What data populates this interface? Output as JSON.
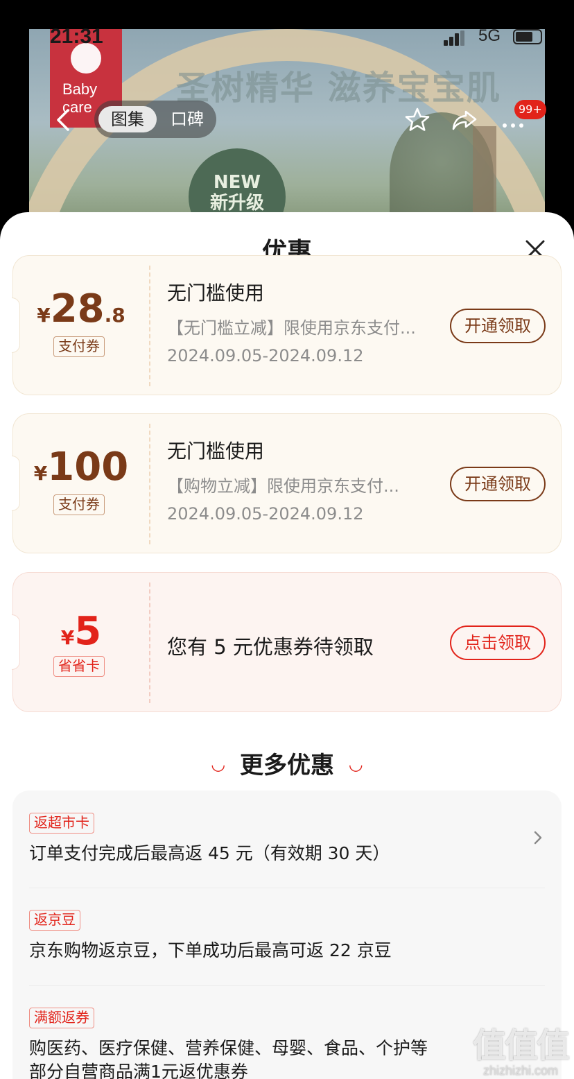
{
  "status_bar": {
    "time": "21:31",
    "network": "5G"
  },
  "product_hero": {
    "brand": "Baby care",
    "slogan": "圣树精华 滋养宝宝肌",
    "badge_line1": "NEW",
    "badge_line2": "新升级"
  },
  "nav": {
    "tabs": [
      "图集",
      "口碑"
    ],
    "active_tab": "图集",
    "message_badge": "99+"
  },
  "sheet": {
    "title": "优惠",
    "coupons": [
      {
        "currency": "¥",
        "amount_int": "28",
        "amount_dec": ".8",
        "tag": "支付券",
        "title": "无门槛使用",
        "desc": "【无门槛立减】限使用京东支付...",
        "date": "2024.09.05-2024.09.12",
        "button": "开通领取"
      },
      {
        "currency": "¥",
        "amount_int": "100",
        "amount_dec": "",
        "tag": "支付券",
        "title": "无门槛使用",
        "desc": "【购物立减】限使用京东支付...",
        "date": "2024.09.05-2024.09.12",
        "button": "开通领取"
      },
      {
        "currency": "¥",
        "amount_int": "5",
        "amount_dec": "",
        "tag": "省省卡",
        "text": "您有 5 元优惠券待领取",
        "button": "点击领取"
      }
    ],
    "more": {
      "title": "更多优惠",
      "items": [
        {
          "tag": "返超市卡",
          "text": "订单支付完成后最高返 45 元（有效期 30 天）"
        },
        {
          "tag": "返京豆",
          "text": "京东购物返京豆，下单成功后最高可返 22 京豆"
        },
        {
          "tag": "满额返券",
          "text": "购医药、医疗保健、营养保健、母婴、食品、个护等",
          "text2": "部分自营商品满1元返优惠券"
        }
      ]
    }
  },
  "watermark": {
    "big": "值值值",
    "small": "zhizhizhi.com"
  },
  "colors": {
    "coupon_brown": "#7a3a18",
    "accent_red": "#e2231a",
    "coupon_bg": "#fdf9f2",
    "card_bg": "#f7f7f7"
  }
}
